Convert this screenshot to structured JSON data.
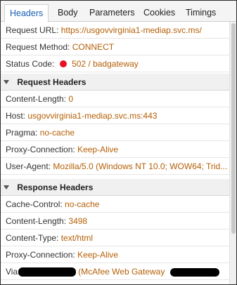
{
  "tabs": [
    {
      "label": "Headers"
    },
    {
      "label": "Body"
    },
    {
      "label": "Parameters"
    },
    {
      "label": "Cookies"
    },
    {
      "label": "Timings"
    }
  ],
  "general": {
    "request_url": {
      "key": "Request URL:",
      "value": "https://usgovvirginia1-mediap.svc.ms/"
    },
    "request_method": {
      "key": "Request Method:",
      "value": "CONNECT"
    },
    "status_code": {
      "key": "Status Code:",
      "value": "502 / badgateway",
      "status_color": "#e81123"
    }
  },
  "request_headers": {
    "title": "Request Headers",
    "items": [
      {
        "key": "Content-Length:",
        "value": "0"
      },
      {
        "key": "Host:",
        "value": "usgovvirginia1-mediap.svc.ms:443"
      },
      {
        "key": "Pragma:",
        "value": "no-cache"
      },
      {
        "key": "Proxy-Connection:",
        "value": "Keep-Alive"
      },
      {
        "key": "User-Agent:",
        "value": "Mozilla/5.0 (Windows NT 10.0; WOW64; Trid..."
      }
    ]
  },
  "response_headers": {
    "title": "Response Headers",
    "items": [
      {
        "key": "Cache-Control:",
        "value": "no-cache"
      },
      {
        "key": "Content-Length:",
        "value": "3498"
      },
      {
        "key": "Content-Type:",
        "value": "text/html"
      },
      {
        "key": "Proxy-Connection:",
        "value": "Keep-Alive"
      },
      {
        "key": "Via:",
        "value": "(McAfee Web Gateway"
      }
    ]
  },
  "colors": {
    "accent": "#1a5fb4",
    "value_text": "#b45f06",
    "error": "#e81123"
  }
}
